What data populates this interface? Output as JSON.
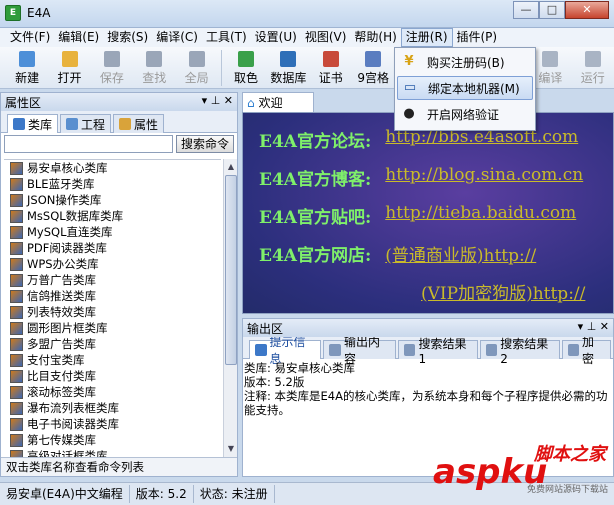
{
  "window": {
    "title": "E4A",
    "icon": "app-logo-icon",
    "minimize": "—",
    "maximize": "□",
    "close": "✕"
  },
  "menu": [
    "文件(F)",
    "编辑(E)",
    "搜索(S)",
    "编译(C)",
    "工具(T)",
    "设置(U)",
    "视图(V)",
    "帮助(H)",
    "注册(R)",
    "插件(P)"
  ],
  "toolbar": [
    {
      "label": "新建",
      "icon": "new-file-icon",
      "enabled": true,
      "color": "#4d8fd8"
    },
    {
      "label": "打开",
      "icon": "open-folder-icon",
      "enabled": true,
      "color": "#e8b23c"
    },
    {
      "label": "保存",
      "icon": "save-icon",
      "enabled": false,
      "color": "#9aa6b8"
    },
    {
      "label": "查找",
      "icon": "find-icon",
      "enabled": false,
      "color": "#9aa6b8"
    },
    {
      "label": "全局",
      "icon": "global-search-icon",
      "enabled": false,
      "color": "#9aa6b8"
    },
    {
      "label": "取色",
      "icon": "color-picker-icon",
      "enabled": true,
      "color": "#3aa04a"
    },
    {
      "label": "数据库",
      "icon": "database-icon",
      "enabled": true,
      "color": "#2e6fb8"
    },
    {
      "label": "证书",
      "icon": "certificate-icon",
      "enabled": true,
      "color": "#c84a3a"
    },
    {
      "label": "9宫格",
      "icon": "grid-icon",
      "enabled": true,
      "color": "#5a7dc0"
    }
  ],
  "toolbar_right": [
    {
      "label": "编译",
      "icon": "compile-icon",
      "enabled": false
    },
    {
      "label": "运行",
      "icon": "run-icon",
      "enabled": false
    }
  ],
  "register_menu": [
    {
      "label": "购买注册码(B)",
      "icon": "yen-icon",
      "glyph": "¥"
    },
    {
      "label": "绑定本地机器(M)",
      "icon": "computer-icon",
      "glyph": "▭"
    },
    {
      "label": "开启网络验证",
      "icon": "qq-penguin-icon",
      "glyph": "●"
    }
  ],
  "property_pane": {
    "title": "属性区",
    "pin": "▾ ⊥ ✕",
    "tabs": [
      "类库",
      "工程",
      "属性"
    ],
    "search_button": "搜索命令",
    "libraries": [
      "易安卓核心类库",
      "BLE蓝牙类库",
      "JSON操作类库",
      "MsSQL数据库类库",
      "MySQL直连类库",
      "PDF阅读器类库",
      "WPS办公类库",
      "万普广告类库",
      "信鸽推送类库",
      "列表特效类库",
      "圆形图片框类库",
      "多盟广告类库",
      "支付宝类库",
      "比目支付类库",
      "滚动标签类库",
      "瀑布流列表框类库",
      "电子书阅读器类库",
      "第七传媒类库",
      "高级对话框类库"
    ],
    "status": "双击类库名称查看命令列表"
  },
  "welcome": {
    "tab": "欢迎",
    "rows": [
      {
        "label": "E4A官方论坛:",
        "link": "http://bbs.e4asoft.com"
      },
      {
        "label": "E4A官方博客:",
        "link": "http://blog.sina.com.cn"
      },
      {
        "label": "E4A官方贴吧:",
        "link": "http://tieba.baidu.com"
      },
      {
        "label": "E4A官方网店:",
        "link": "(普通商业版)http://"
      },
      {
        "label": "",
        "link": "(VIP加密狗版)http://"
      }
    ]
  },
  "output_pane": {
    "title": "输出区",
    "tabs": [
      "提示信息",
      "输出内容",
      "搜索结果1",
      "搜索结果2",
      "加密"
    ],
    "lines": [
      "类库: 易安卓核心类库",
      "版本: 5.2版",
      "注释: 本类库是E4A的核心类库，为系统本身和每个子程序提供必需的功能支持。"
    ]
  },
  "statusbar": [
    "易安卓(E4A)中文编程",
    "版本: 5.2",
    "状态: 未注册"
  ],
  "watermark": {
    "top": "脚本之家",
    "big": "aspku",
    "small": "免费网站源码下载站"
  }
}
